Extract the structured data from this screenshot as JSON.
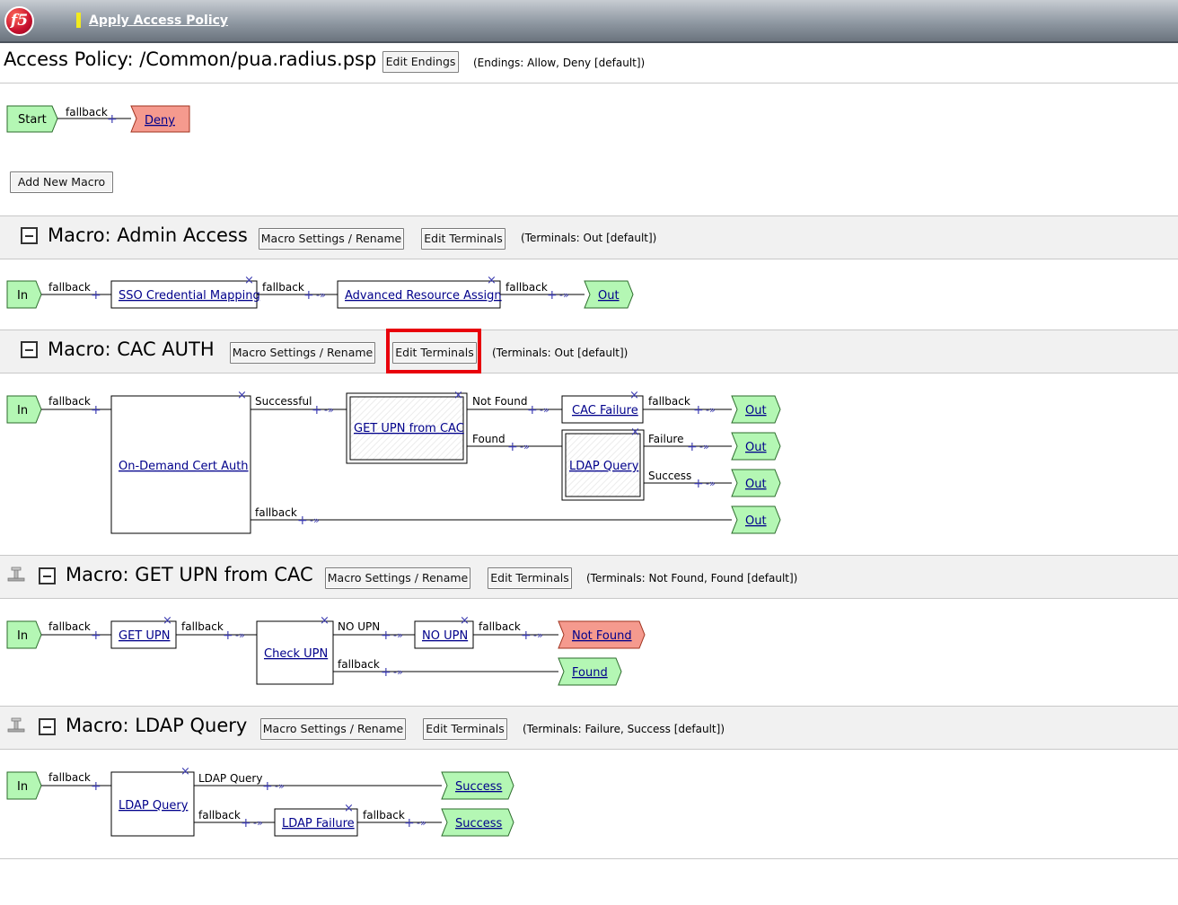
{
  "header": {
    "logo_text": "f5",
    "title_link": "Apply Access Policy"
  },
  "policy": {
    "title": "Access Policy: /Common/pua.radius.psp",
    "edit_endings_label": "Edit Endings",
    "endings_note": "(Endings: Allow, Deny [default])",
    "flow": {
      "start": "Start",
      "branch": "fallback",
      "end": "Deny"
    },
    "add_macro_label": "Add New Macro"
  },
  "common": {
    "macro_settings_label": "Macro Settings / Rename",
    "edit_terminals_label": "Edit Terminals",
    "in_label": "In",
    "plus": "+",
    "close": "×"
  },
  "macros": [
    {
      "title": "Macro: Admin Access",
      "terminals_note": "(Terminals: Out [default])",
      "nodes": {
        "n1": "SSO Credential Mapping",
        "n2": "Advanced Resource Assign"
      },
      "branches": {
        "b0": "fallback",
        "b1": "fallback",
        "b2": "fallback"
      },
      "terminals": {
        "t1": "Out"
      }
    },
    {
      "title": "Macro: CAC AUTH",
      "terminals_note": "(Terminals: Out [default])",
      "nodes": {
        "n1": "On-Demand Cert Auth",
        "n2": "GET UPN from CAC",
        "n3": "CAC Failure",
        "n4": "LDAP Query"
      },
      "branches": {
        "b0": "fallback",
        "b1": "Successful",
        "b2": "fallback",
        "b3": "Not Found",
        "b4": "Found",
        "b5": "fallback",
        "b6": "Failure",
        "b7": "Success"
      },
      "terminals": {
        "t1": "Out",
        "t2": "Out",
        "t3": "Out",
        "t4": "Out"
      }
    },
    {
      "title": "Macro: GET UPN from CAC",
      "terminals_note": "(Terminals: Not Found, Found [default])",
      "nodes": {
        "n1": "GET UPN",
        "n2": "Check UPN",
        "n3": "NO UPN"
      },
      "branches": {
        "b0": "fallback",
        "b1": "fallback",
        "b2": "NO UPN",
        "b3": "fallback",
        "b4": "fallback"
      },
      "terminals": {
        "t1": "Not Found",
        "t2": "Found"
      }
    },
    {
      "title": "Macro: LDAP Query",
      "terminals_note": "(Terminals: Failure, Success [default])",
      "nodes": {
        "n1": "LDAP Query",
        "n2": "LDAP Failure"
      },
      "branches": {
        "b0": "fallback",
        "b1": "LDAP Query",
        "b2": "fallback",
        "b3": "fallback"
      },
      "terminals": {
        "t1": "Success",
        "t2": "Success"
      }
    }
  ],
  "colors": {
    "green_fill": "#b4f7b4",
    "red_fill": "#f59a8e",
    "line_blue": "#3a3ab0",
    "link_blue": "#00008b",
    "highlight": "#e8000b"
  }
}
